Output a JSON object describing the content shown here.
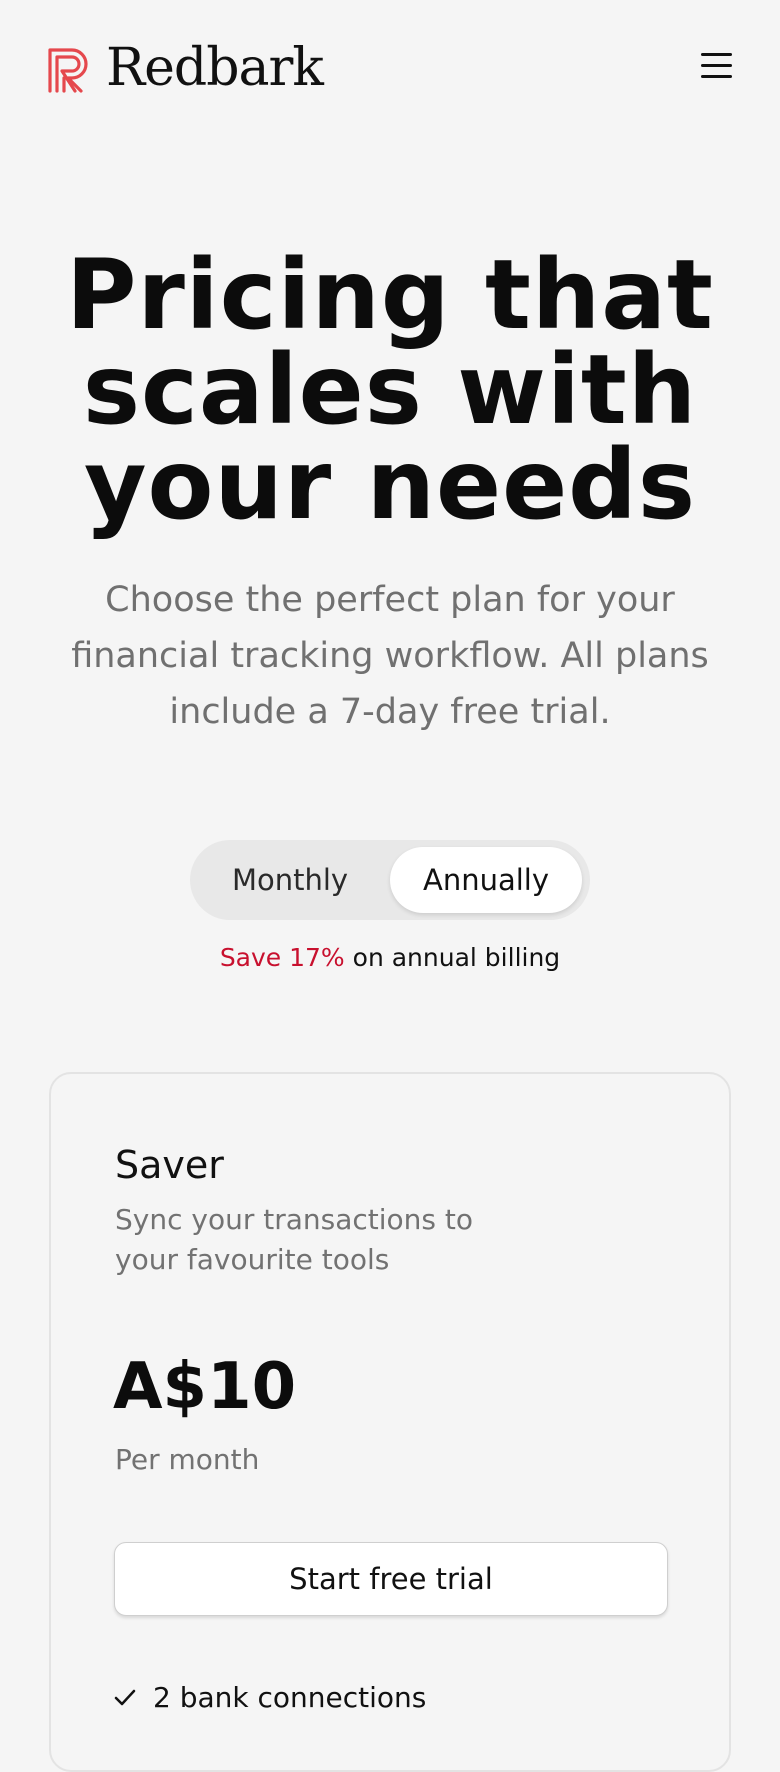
{
  "brand": {
    "name": "Redbark",
    "accent_color": "#e5484d"
  },
  "header": {
    "menu_icon": "hamburger-menu-icon"
  },
  "hero": {
    "title": "Pricing that scales with your needs",
    "subtitle": "Choose the perfect plan for your financial tracking workflow. All plans include a 7-day free trial."
  },
  "billing_toggle": {
    "options": [
      {
        "label": "Monthly",
        "selected": false
      },
      {
        "label": "Annually",
        "selected": true
      }
    ],
    "save_highlight": "Save 17%",
    "save_text": " on annual billing",
    "save_color": "#c8102e"
  },
  "plans": [
    {
      "name": "Saver",
      "description": "Sync your transactions to your favourite tools",
      "price": "A$10",
      "period": "Per month",
      "cta": "Start free trial",
      "features": [
        "2 bank connections"
      ]
    }
  ]
}
